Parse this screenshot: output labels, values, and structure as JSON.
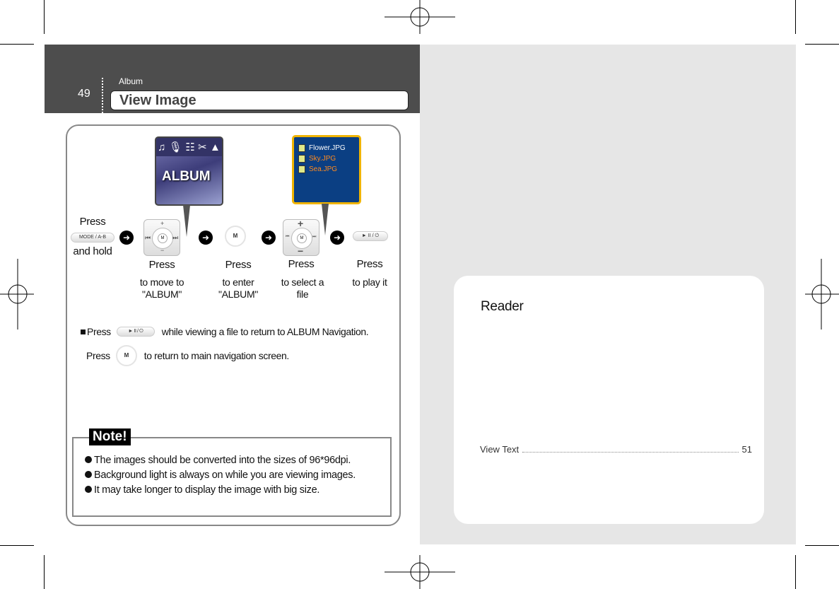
{
  "header": {
    "page_number": "49",
    "section": "Album",
    "title": "View Image"
  },
  "steps": [
    {
      "press": "Press",
      "button": "MODE / A-B",
      "after": "and hold"
    },
    {
      "press": "Press",
      "desc1": "to move to",
      "desc2": "\"ALBUM\""
    },
    {
      "press": "Press",
      "button": "M",
      "desc1": "to enter",
      "desc2": "\"ALBUM\""
    },
    {
      "press": "Press",
      "desc1": "to select a",
      "desc2": "file"
    },
    {
      "press": "Press",
      "button": "► II / ⏻",
      "desc1": "to play it"
    }
  ],
  "album_screen": {
    "label": "ALBUM",
    "icons": [
      "♫",
      "🎙",
      "☷",
      "✂",
      "▲"
    ]
  },
  "file_screen": {
    "files": [
      {
        "name": "Flower.JPG",
        "color": "#ffffff"
      },
      {
        "name": "Sky.JPG",
        "color": "#ff8a1e"
      },
      {
        "name": "Sea.JPG",
        "color": "#ff8a1e"
      }
    ]
  },
  "instructions": [
    {
      "pre": "Press",
      "button": "► II / ⏻",
      "post": "while viewing a file to return to ALBUM Navigation."
    },
    {
      "pre": "Press",
      "button": "M",
      "post": "to return to main navigation screen."
    }
  ],
  "note": {
    "label": "Note!",
    "items": [
      "The images should be converted into the sizes of 96*96dpi.",
      "Background light is always on while you are viewing images.",
      "It may take longer to display the image with big size."
    ]
  },
  "toc": {
    "heading": "Reader",
    "entries": [
      {
        "label": "View Text",
        "page": "51"
      }
    ]
  }
}
